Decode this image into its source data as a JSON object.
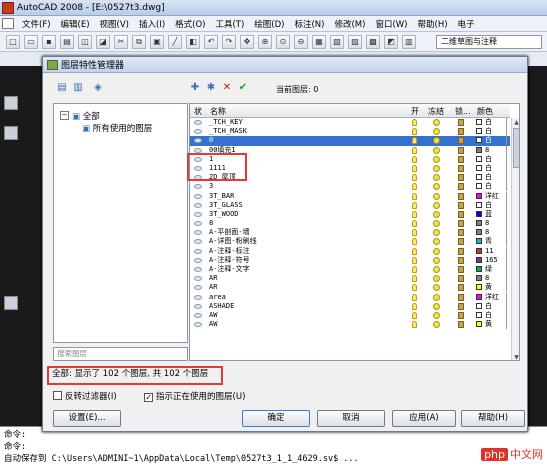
{
  "window": {
    "title": "AutoCAD 2008 - [E:\\0527t3.dwg]"
  },
  "menu": [
    "文件(F)",
    "编辑(E)",
    "视图(V)",
    "插入(I)",
    "格式(O)",
    "工具(T)",
    "绘图(D)",
    "标注(N)",
    "修改(M)",
    "窗口(W)",
    "帮助(H)",
    "电子",
    "文",
    "编辑",
    "视图",
    "插入",
    "格式",
    "工具",
    "绘图",
    "标注",
    "修改",
    "窗口",
    "帮助",
    "电子"
  ],
  "toolbar": {
    "workspace": "二维草图与注释"
  },
  "dialog": {
    "title": "图层特性管理器",
    "current_layer_label": "当前图层: 0",
    "tree": {
      "root": "全部",
      "child": "所有使用的图层"
    },
    "filter_placeholder": "搜索图层",
    "columns": {
      "status": "状",
      "name": "名称",
      "on": "开",
      "freeze": "冻结",
      "lock": "锁...",
      "color": "颜色"
    },
    "layers": [
      {
        "name": "_TCH_KEY",
        "color": "白",
        "swatch": "#ffffff"
      },
      {
        "name": "_TCH_MASK",
        "color": "白",
        "swatch": "#ffffff"
      },
      {
        "name": "0",
        "color": "白",
        "swatch": "#ffffff"
      },
      {
        "name": "00填充1",
        "color": "8",
        "swatch": "#808080"
      },
      {
        "name": "1",
        "color": "白",
        "swatch": "#ffffff"
      },
      {
        "name": "1111",
        "color": "白",
        "swatch": "#ffffff"
      },
      {
        "name": "2D_屋顶",
        "color": "白",
        "swatch": "#ffffff"
      },
      {
        "name": "3",
        "color": "白",
        "swatch": "#ffffff"
      },
      {
        "name": "3T_BAR",
        "color": "洋红",
        "swatch": "#ff00ff"
      },
      {
        "name": "3T_GLASS",
        "color": "白",
        "swatch": "#ffffff"
      },
      {
        "name": "3T_WOOD",
        "color": "蓝",
        "swatch": "#0000ff"
      },
      {
        "name": "8",
        "color": "8",
        "swatch": "#808080"
      },
      {
        "name": "A-平剖面-墙",
        "color": "8",
        "swatch": "#808080"
      },
      {
        "name": "A-详图-粉刷线",
        "color": "青",
        "swatch": "#00c0c0"
      },
      {
        "name": "A-注释-标注",
        "color": "11",
        "swatch": "#d43030"
      },
      {
        "name": "A-注释-符号",
        "color": "165",
        "swatch": "#7a2fb3"
      },
      {
        "name": "A-注释-文字",
        "color": "绿",
        "swatch": "#00b050"
      },
      {
        "name": "AR",
        "color": "8",
        "swatch": "#808080"
      },
      {
        "name": "AR",
        "color": "黄",
        "swatch": "#ffff00"
      },
      {
        "name": "area",
        "color": "洋红",
        "swatch": "#ff00ff"
      },
      {
        "name": "ASHADE",
        "color": "白",
        "swatch": "#ffffff"
      },
      {
        "name": "AW",
        "color": "白",
        "swatch": "#ffffff"
      },
      {
        "name": "AW",
        "color": "黄",
        "swatch": "#ffff00"
      }
    ],
    "selected_index": 2,
    "status_text": "全部: 显示了 102 个图层, 共 102 个图层",
    "invert_filter_label": "反转过滤器(I)",
    "indicate_used_label": "指示正在使用的图层(U)",
    "buttons": {
      "settings": "设置(E)...",
      "ok": "确定",
      "cancel": "取消",
      "apply": "应用(A)",
      "help": "帮助(H)"
    }
  },
  "command": {
    "line1": "命令:",
    "line2": "命令:",
    "line3": "自动保存到 C:\\Users\\ADMINI~1\\AppData\\Local\\Temp\\0527t3_1_1_4629.sv$ ..."
  },
  "watermark": {
    "badge": "php",
    "text": "中文网"
  }
}
